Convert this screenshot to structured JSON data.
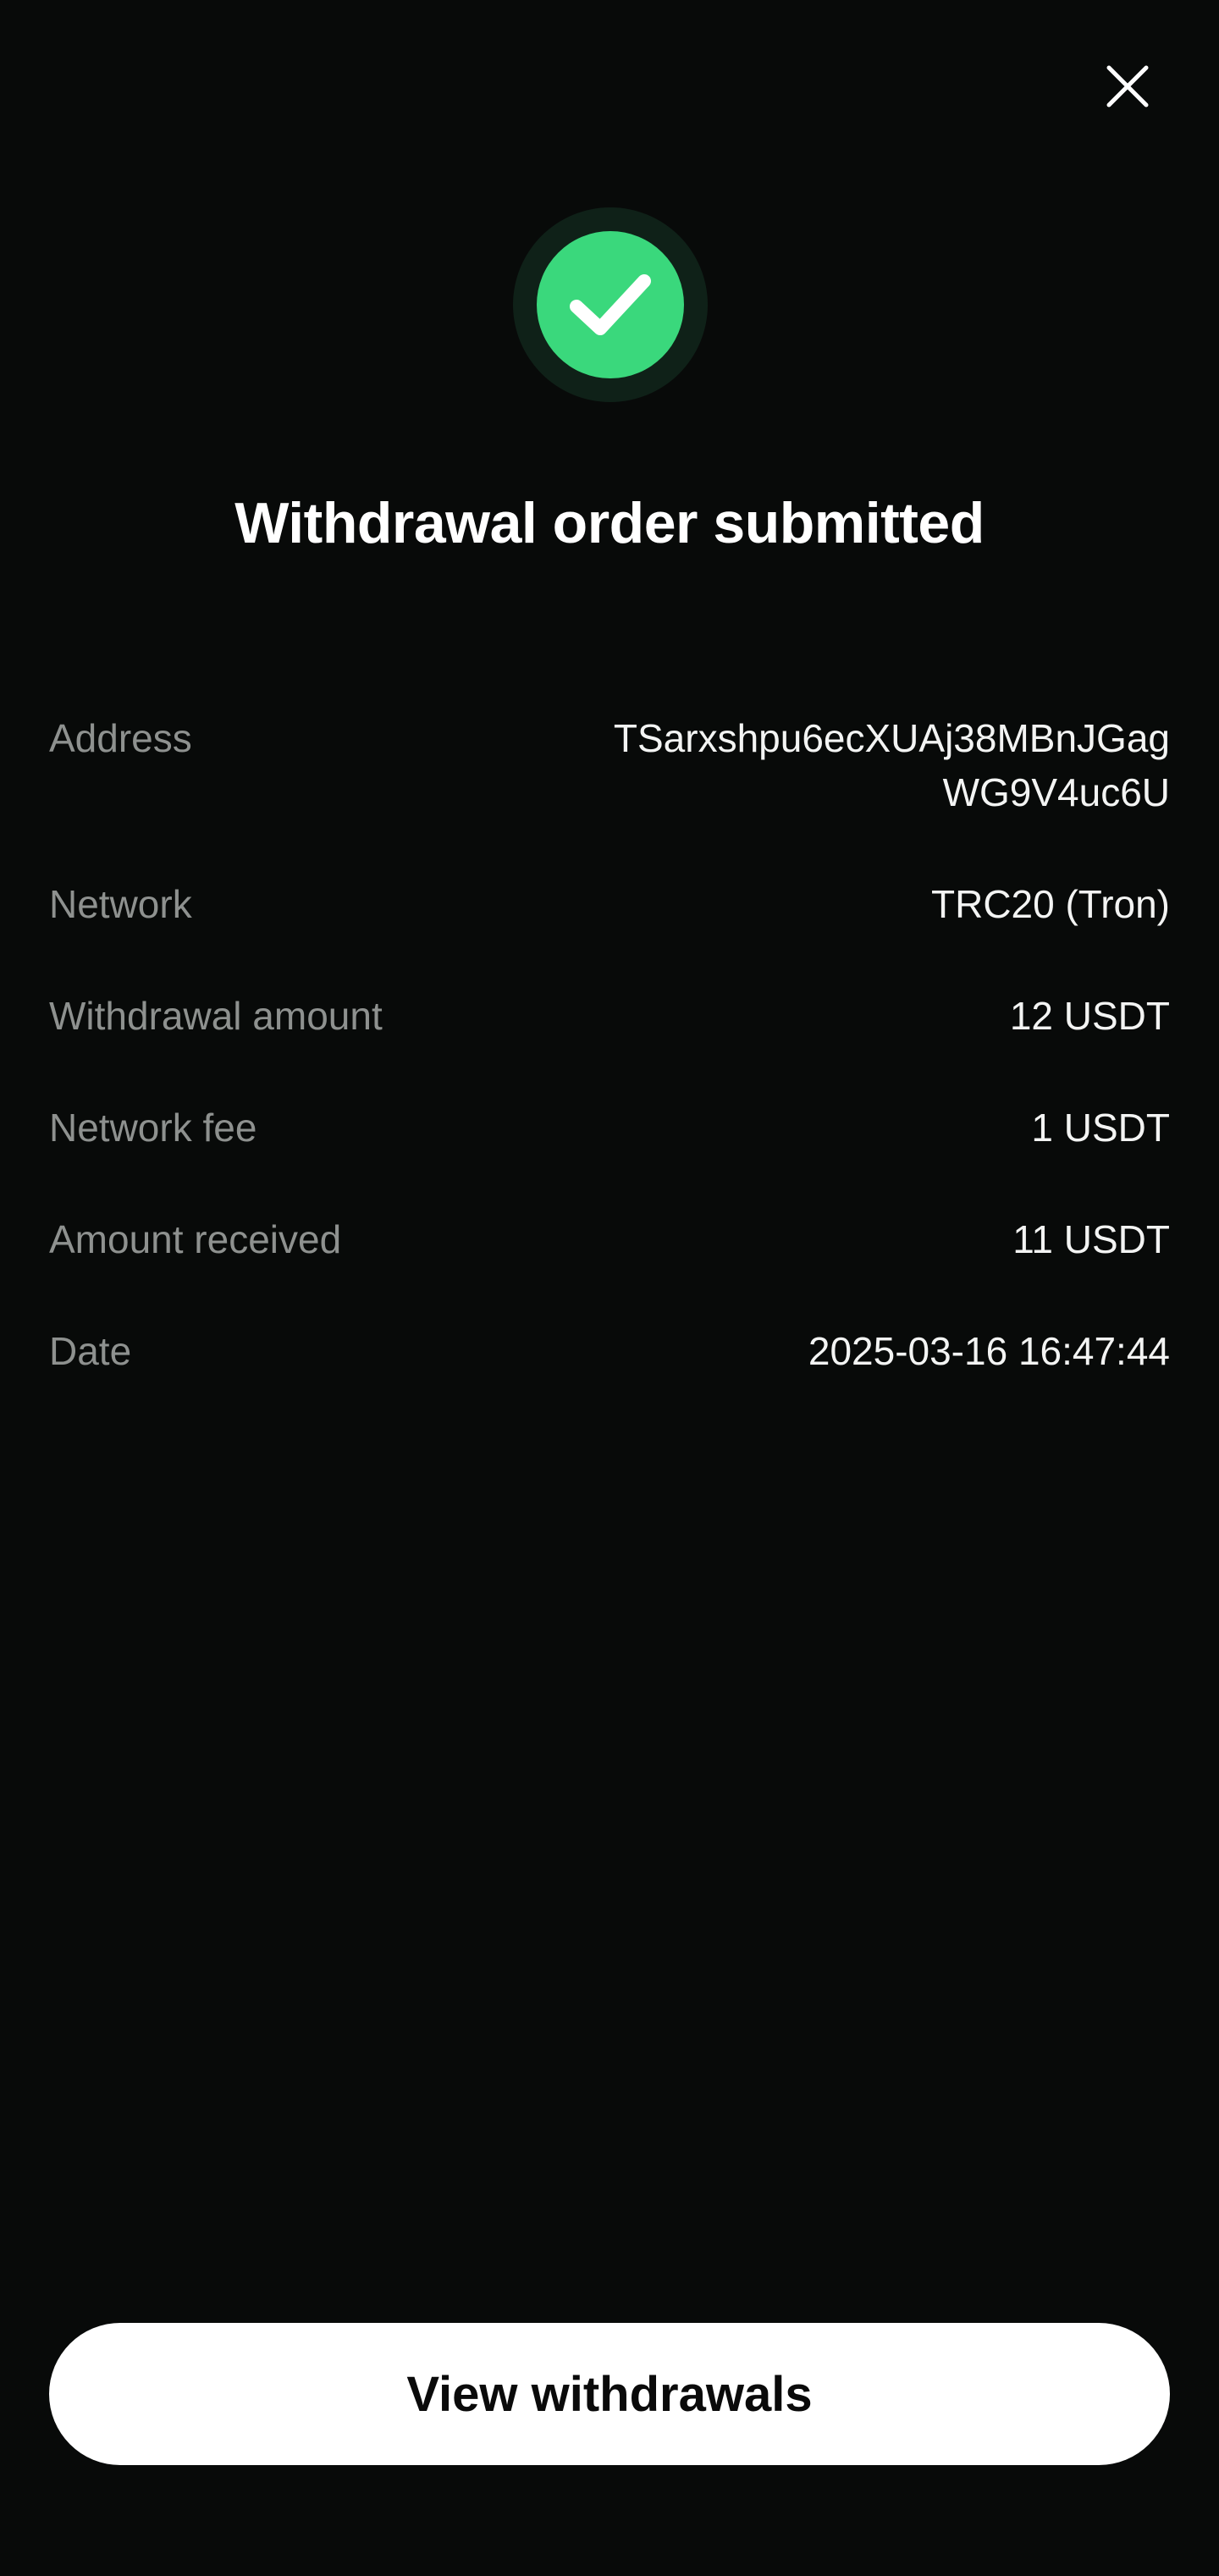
{
  "header": {
    "close_icon": "close-icon"
  },
  "status": {
    "icon": "check-icon",
    "icon_color": "#3ad87c",
    "title": "Withdrawal order submitted"
  },
  "details": {
    "address": {
      "label": "Address",
      "value_line1": "TSarxshpu6ecXUAj38MBnJGag",
      "value_line2": "WG9V4uc6U"
    },
    "network": {
      "label": "Network",
      "value": "TRC20 (Tron)"
    },
    "withdrawal_amount": {
      "label": "Withdrawal amount",
      "value": "12 USDT"
    },
    "network_fee": {
      "label": "Network fee",
      "value": "1 USDT"
    },
    "amount_received": {
      "label": "Amount received",
      "value": "11 USDT"
    },
    "date": {
      "label": "Date",
      "value": "2025-03-16 16:47:44"
    }
  },
  "footer": {
    "view_button_label": "View withdrawals"
  },
  "colors": {
    "background": "#080a09",
    "accent_green": "#3ad87c",
    "label_gray": "#8e918f",
    "button_bg": "#ffffff"
  }
}
